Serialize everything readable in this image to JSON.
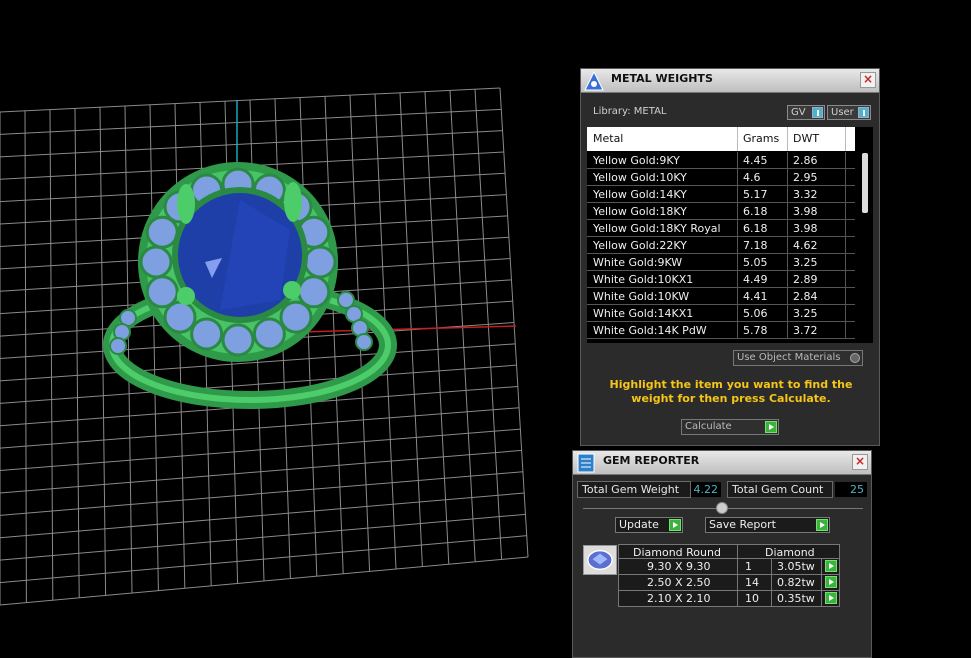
{
  "viewport": {
    "grid_color": "#8a8a8a",
    "axis_x_color": "#c0201e",
    "axis_y_color": "#1aa6b7",
    "metal_color": "#3cb35a",
    "center_gem_color": "#1e3fa8",
    "side_gem_color": "#7e9fe0"
  },
  "metal_weights": {
    "title": "METAL WEIGHTS",
    "library": "Library: METAL",
    "gv_label": "GV",
    "user_label": "User",
    "columns": [
      "Metal",
      "Grams",
      "DWT"
    ],
    "rows": [
      {
        "metal": "Yellow Gold:9KY",
        "grams": "4.45",
        "dwt": "2.86"
      },
      {
        "metal": "Yellow Gold:10KY",
        "grams": "4.6",
        "dwt": "2.95"
      },
      {
        "metal": "Yellow Gold:14KY",
        "grams": "5.17",
        "dwt": "3.32"
      },
      {
        "metal": "Yellow Gold:18KY",
        "grams": "6.18",
        "dwt": "3.98"
      },
      {
        "metal": "Yellow Gold:18KY Royal",
        "grams": "6.18",
        "dwt": "3.98"
      },
      {
        "metal": "Yellow Gold:22KY",
        "grams": "7.18",
        "dwt": "4.62"
      },
      {
        "metal": "White Gold:9KW",
        "grams": "5.05",
        "dwt": "3.25"
      },
      {
        "metal": "White Gold:10KX1",
        "grams": "4.49",
        "dwt": "2.89"
      },
      {
        "metal": "White Gold:10KW",
        "grams": "4.41",
        "dwt": "2.84"
      },
      {
        "metal": "White Gold:14KX1",
        "grams": "5.06",
        "dwt": "3.25"
      },
      {
        "metal": "White Gold:14K PdW",
        "grams": "5.78",
        "dwt": "3.72"
      }
    ],
    "use_object_materials": "Use Object Materials",
    "instruction": "Highlight the item you want to find the weight for then press Calculate.",
    "calculate_label": "Calculate"
  },
  "gem_reporter": {
    "title": "GEM REPORTER",
    "total_weight_label": "Total Gem Weight",
    "total_weight_value": "4.22",
    "total_count_label": "Total Gem Count",
    "total_count_value": "25",
    "update_label": "Update",
    "save_report_label": "Save Report",
    "table_header_shape": "Diamond Round",
    "table_header_material": "Diamond",
    "rows": [
      {
        "size": "9.30 X 9.30",
        "count": "1",
        "weight": "3.05tw"
      },
      {
        "size": "2.50 X 2.50",
        "count": "14",
        "weight": "0.82tw"
      },
      {
        "size": "2.10 X 2.10",
        "count": "10",
        "weight": "0.35tw"
      }
    ]
  }
}
